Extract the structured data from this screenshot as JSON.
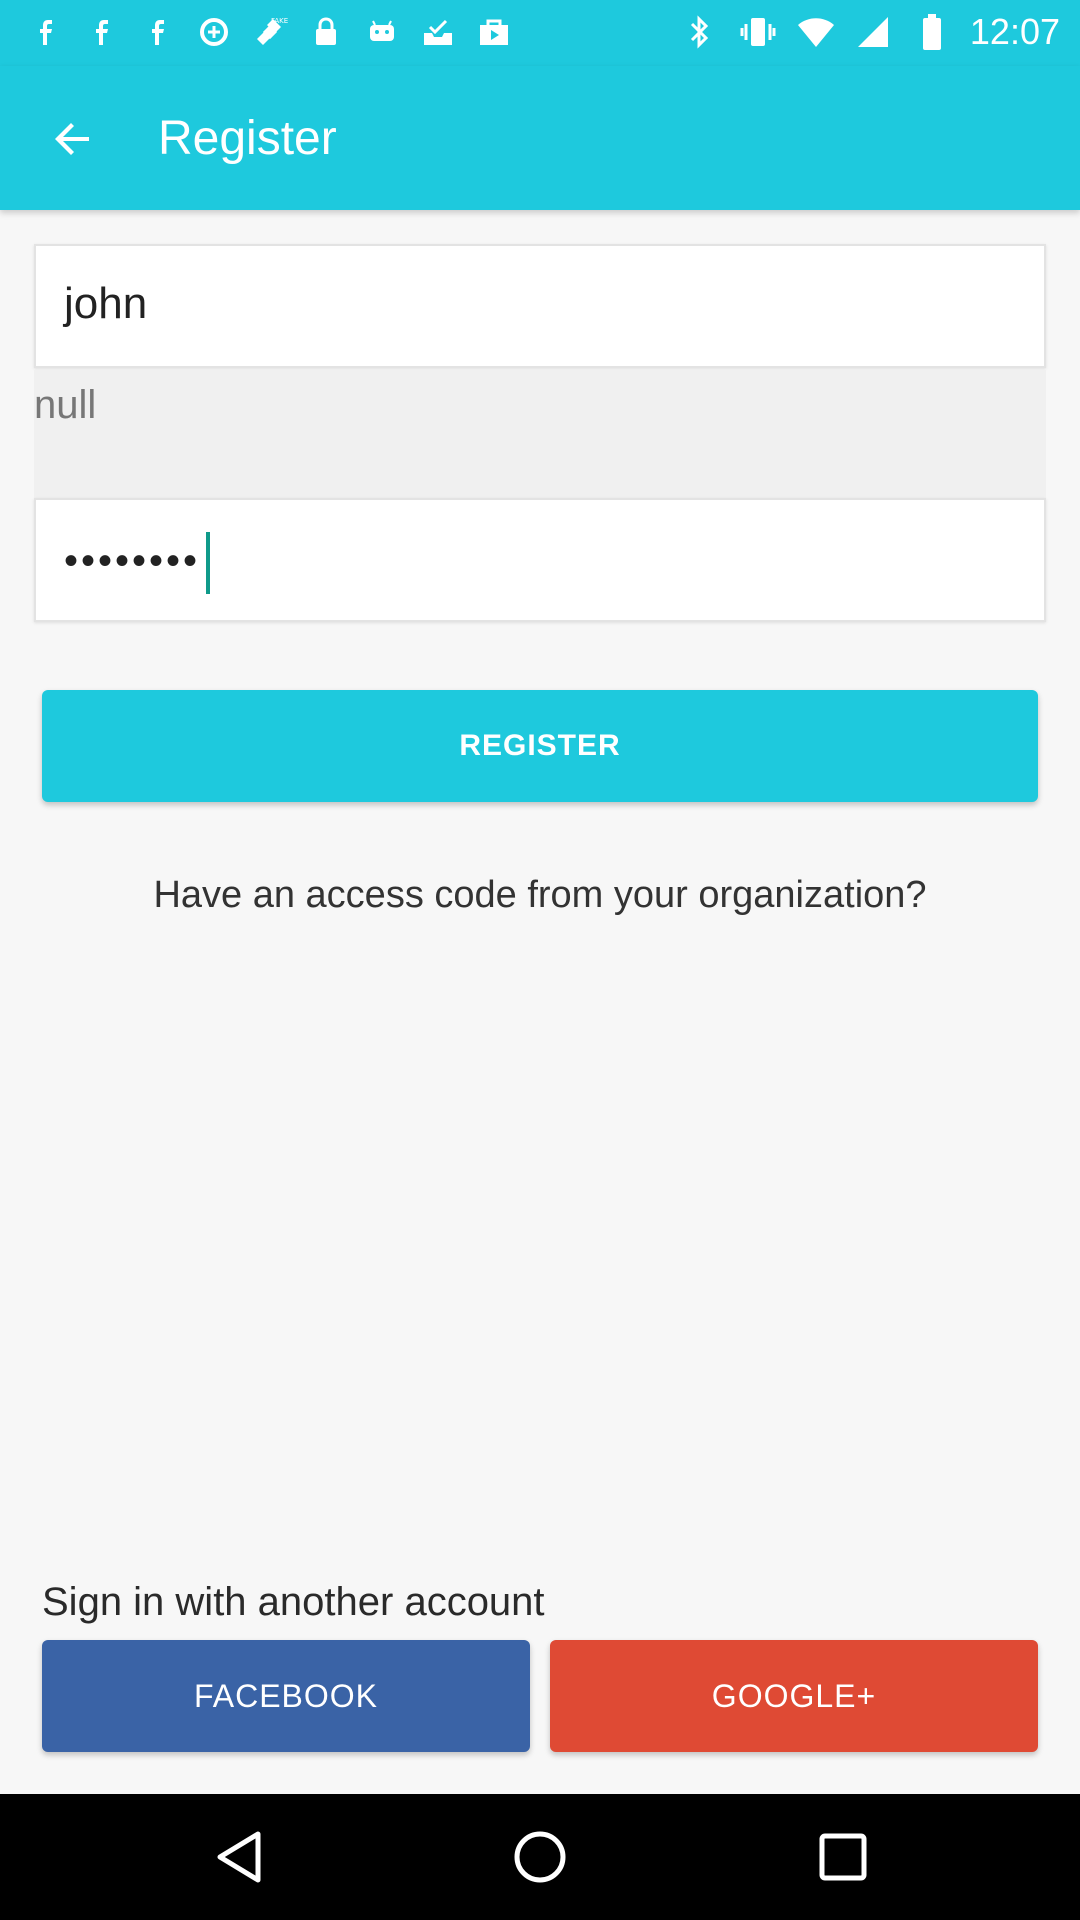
{
  "statusbar": {
    "time": "12:07",
    "left_icons": [
      "facebook-icon",
      "facebook-icon",
      "facebook-icon",
      "data-saver-icon",
      "fake-gps-icon",
      "lock-icon",
      "android-icon",
      "inbox-check-icon",
      "play-store-icon"
    ],
    "right_icons": [
      "bluetooth-icon",
      "vibrate-icon",
      "wifi-icon",
      "signal-icon",
      "battery-icon"
    ]
  },
  "appbar": {
    "title": "Register",
    "back_icon": "arrow-back-icon"
  },
  "form": {
    "name_value": "john",
    "null_text": "null",
    "password_dots": "••••••••"
  },
  "buttons": {
    "register_label": "REGISTER",
    "access_code_text": "Have an access code from your organization?",
    "signin_label": "Sign in with another account",
    "facebook_label": "FACEBOOK",
    "google_label": "GOOGLE+"
  },
  "colors": {
    "accent": "#1ec9dd",
    "facebook": "#3a63a6",
    "google": "#df4a34"
  },
  "navbar": {
    "icons": [
      "back-triangle-icon",
      "home-circle-icon",
      "recents-square-icon"
    ]
  }
}
